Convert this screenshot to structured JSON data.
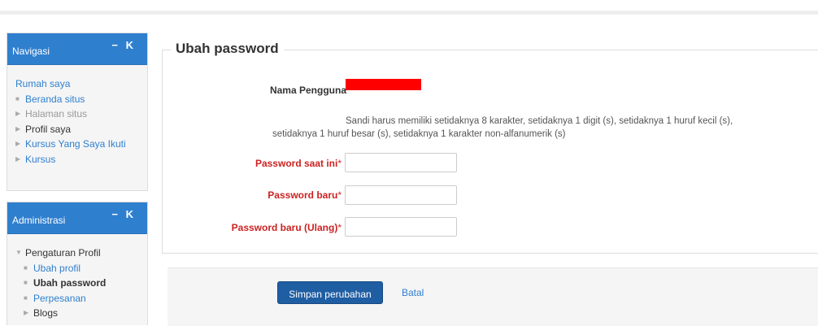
{
  "navigation_block": {
    "title": "Navigasi",
    "controls": "− K",
    "items": [
      {
        "label": "Rumah saya"
      },
      {
        "label": "Beranda situs"
      },
      {
        "label": "Halaman situs"
      },
      {
        "label": "Profil saya"
      },
      {
        "label": "Kursus Yang Saya Ikuti"
      },
      {
        "label": "Kursus"
      }
    ]
  },
  "admin_block": {
    "title": "Administrasi",
    "controls": "− K",
    "items": [
      {
        "label": "Pengaturan Profil"
      },
      {
        "label": "Ubah profil"
      },
      {
        "label": "Ubah password"
      },
      {
        "label": "Perpesanan"
      },
      {
        "label": "Blogs"
      }
    ]
  },
  "form": {
    "legend": "Ubah password",
    "username_label": "Nama Pengguna",
    "note_line1": "Sandi harus memiliki setidaknya 8 karakter, setidaknya 1 digit (s), setidaknya 1 huruf kecil (s),",
    "note_line2": "setidaknya 1 huruf besar (s), setidaknya 1 karakter non-alfanumerik (s)",
    "current_password_label": "Password saat ini",
    "new_password_label": "Password baru",
    "new_password2_label": "Password baru (Ulang)",
    "required_mark": "*",
    "current_password_value": "",
    "new_password_value": "",
    "new_password2_value": ""
  },
  "actions": {
    "save_label": "Simpan perubahan",
    "cancel_label": "Batal"
  },
  "colors": {
    "header_blue": "#2f7fcf",
    "button_blue": "#1f5ea3",
    "required_red": "#cc2222",
    "redaction": "#ff0000"
  }
}
